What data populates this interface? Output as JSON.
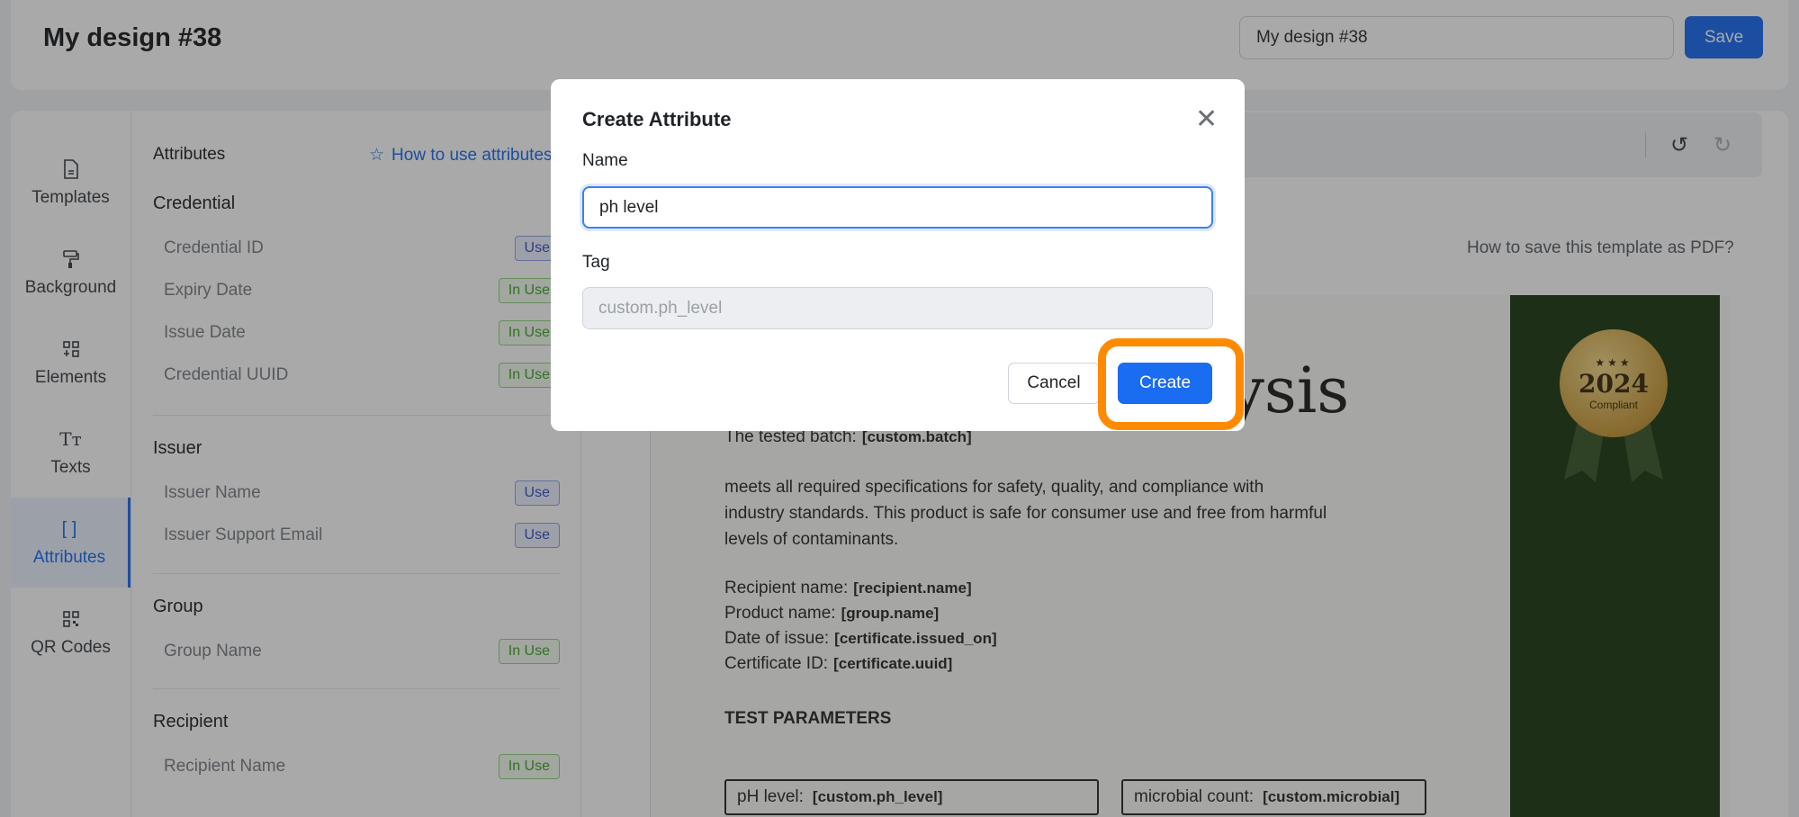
{
  "header": {
    "title": "My design #38",
    "design_name_value": "My design #38",
    "save_label": "Save"
  },
  "sidenav": {
    "items": [
      {
        "label": "Templates",
        "icon": "file-icon"
      },
      {
        "label": "Background",
        "icon": "paint-roller-icon"
      },
      {
        "label": "Elements",
        "icon": "elements-icon"
      },
      {
        "label": "Texts",
        "icon": "text-icon"
      },
      {
        "label": "Attributes",
        "icon": "brackets-icon",
        "active": true
      },
      {
        "label": "QR Codes",
        "icon": "qr-code-icon"
      }
    ]
  },
  "attributes": {
    "heading": "Attributes",
    "howto_label": "How to use attributes",
    "use_label": "Use",
    "in_use_label": "In Use",
    "sections": {
      "credential": "Credential",
      "issuer": "Issuer",
      "group": "Group",
      "recipient": "Recipient"
    },
    "rows": {
      "credential_id": "Credential ID",
      "expiry_date": "Expiry Date",
      "issue_date": "Issue Date",
      "credential_uuid": "Credential UUID",
      "issuer_name": "Issuer Name",
      "issuer_support_email": "Issuer Support Email",
      "group_name": "Group Name",
      "recipient_name": "Recipient Name"
    }
  },
  "canvas": {
    "pdf_link": "How to save this template as PDF?",
    "title_fragment": "lysis",
    "seal": {
      "year": "2024",
      "label": "Compliant",
      "stars": "★★★"
    },
    "tested_batch_label": "The tested batch:",
    "tested_batch_tag": "[custom.batch]",
    "body_line1": "meets all required specifications for safety, quality, and compliance with",
    "body_line2": "industry standards. This product is safe for consumer use and free from harmful",
    "body_line3": "levels of contaminants.",
    "recipient_label": "Recipient name:",
    "recipient_tag": "[recipient.name]",
    "product_label": "Product name:",
    "product_tag": "[group.name]",
    "date_label": "Date of issue:",
    "date_tag": "[certificate.issued_on]",
    "certid_label": "Certificate ID:",
    "certid_tag": "[certificate.uuid]",
    "params_heading": "TEST PARAMETERS",
    "ph_label": "pH level:",
    "ph_tag": "[custom.ph_level]",
    "micro_label": "microbial count:",
    "micro_tag": "[custom.microbial]"
  },
  "modal": {
    "title": "Create Attribute",
    "name_label": "Name",
    "name_value": "ph level",
    "tag_label": "Tag",
    "tag_value": "custom.ph_level",
    "cancel_label": "Cancel",
    "create_label": "Create"
  },
  "colors": {
    "primary": "#1a6cf0",
    "highlight": "#ff8a00",
    "ribbon": "#1e3a12",
    "in_use": "#3fa52b"
  }
}
